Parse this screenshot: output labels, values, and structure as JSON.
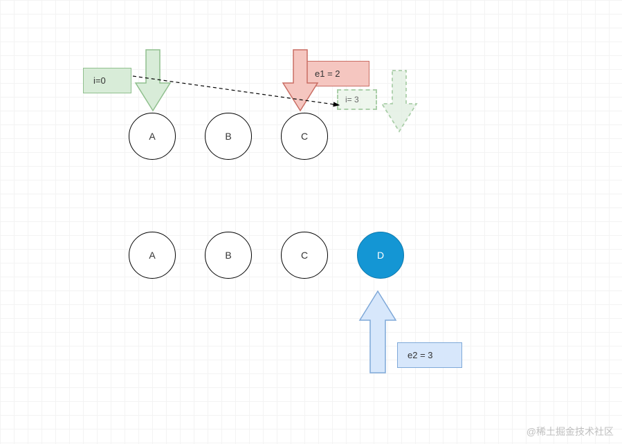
{
  "labels": {
    "i0": "i=0",
    "e1": "e1 = 2",
    "i3": "i= 3",
    "e2": "e2 = 3"
  },
  "row1": {
    "a": "A",
    "b": "B",
    "c": "C"
  },
  "row2": {
    "a": "A",
    "b": "B",
    "c": "C",
    "d": "D"
  },
  "watermark": "@稀土掘金技术社区",
  "colors": {
    "green_fill": "#d8ecd8",
    "green_stroke": "#8fbf8d",
    "red_fill": "#f5c6c0",
    "red_stroke": "#c96d63",
    "blue_fill": "#d7e7fb",
    "blue_stroke": "#7ea8d8",
    "node_blue": "#1496d4"
  }
}
